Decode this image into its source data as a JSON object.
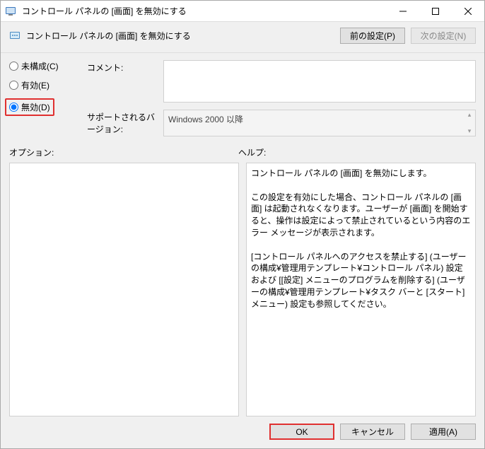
{
  "window": {
    "title": "コントロール パネルの [画面] を無効にする"
  },
  "header": {
    "title": "コントロール パネルの [画面] を無効にする",
    "prev_btn": "前の設定(P)",
    "next_btn": "次の設定(N)"
  },
  "radio": {
    "unconfigured": "未構成(C)",
    "enabled": "有効(E)",
    "disabled": "無効(D)"
  },
  "fields": {
    "comment_label": "コメント:",
    "comment_value": "",
    "support_label": "サポートされるバージョン:",
    "support_value": "Windows 2000 以降"
  },
  "mid": {
    "options_label": "オプション:",
    "help_label": "ヘルプ:"
  },
  "help": {
    "text": "コントロール パネルの [画面] を無効にします。\n\nこの設定を有効にした場合、コントロール パネルの [画面] は起動されなくなります。ユーザーが [画面] を開始すると、操作は設定によって禁止されているという内容のエラー メッセージが表示されます。\n\n[コントロール パネルへのアクセスを禁止する] (ユーザーの構成¥管理用テンプレート¥コントロール パネル) 設定および [[設定] メニューのプログラムを削除する] (ユーザーの構成¥管理用テンプレート¥タスク バーと [スタート] メニュー) 設定も参照してください。"
  },
  "footer": {
    "ok": "OK",
    "cancel": "キャンセル",
    "apply": "適用(A)"
  }
}
